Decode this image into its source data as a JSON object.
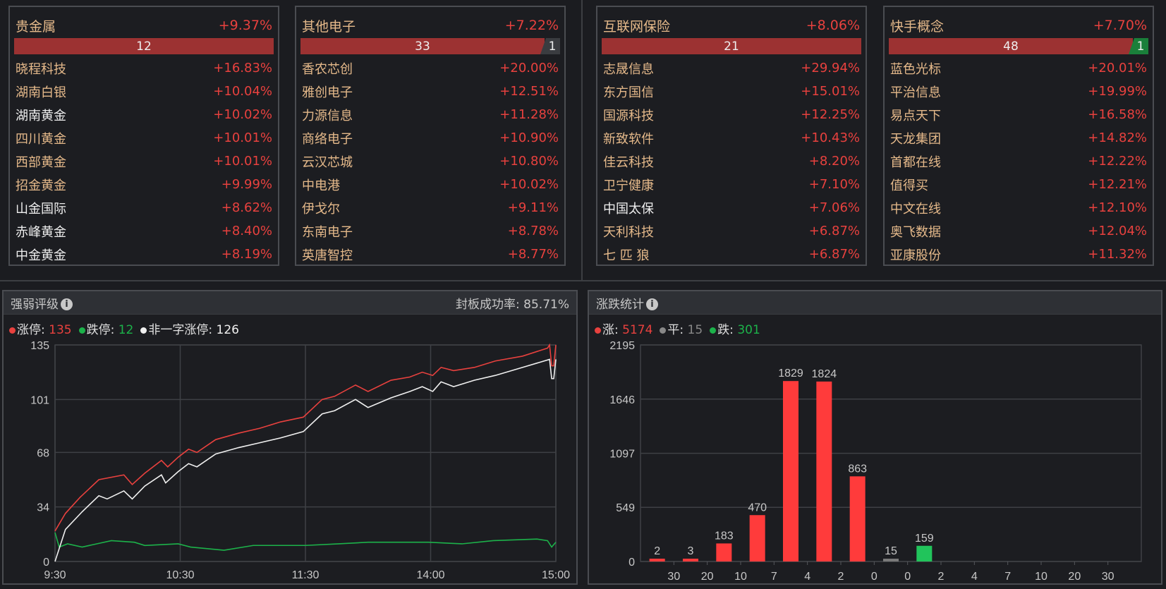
{
  "colors": {
    "up": "#e8413e",
    "down": "#1cb24a",
    "flat": "#888888",
    "white": "#f0f0f0",
    "bar_up": "#ff3b3b",
    "bar_down": "#21c45b",
    "bar_flat": "#7a7a7a"
  },
  "sectors": [
    {
      "name": "贵金属",
      "pct": "+9.37%",
      "up_count": "12",
      "down_count": null,
      "stocks": [
        {
          "name": "晓程科技",
          "pct": "+16.83%",
          "limit": true
        },
        {
          "name": "湖南白银",
          "pct": "+10.04%",
          "limit": true
        },
        {
          "name": "湖南黄金",
          "pct": "+10.02%",
          "limit": false
        },
        {
          "name": "四川黄金",
          "pct": "+10.01%",
          "limit": true
        },
        {
          "name": "西部黄金",
          "pct": "+10.01%",
          "limit": true
        },
        {
          "name": "招金黄金",
          "pct": "+9.99%",
          "limit": true
        },
        {
          "name": "山金国际",
          "pct": "+8.62%",
          "limit": false
        },
        {
          "name": "赤峰黄金",
          "pct": "+8.40%",
          "limit": false
        },
        {
          "name": "中金黄金",
          "pct": "+8.19%",
          "limit": false
        }
      ]
    },
    {
      "name": "其他电子",
      "pct": "+7.22%",
      "up_count": "33",
      "down_count": "1",
      "down_style": "gray",
      "stocks": [
        {
          "name": "香农芯创",
          "pct": "+20.00%",
          "limit": true
        },
        {
          "name": "雅创电子",
          "pct": "+12.51%",
          "limit": true
        },
        {
          "name": "力源信息",
          "pct": "+11.28%",
          "limit": true
        },
        {
          "name": "商络电子",
          "pct": "+10.90%",
          "limit": true
        },
        {
          "name": "云汉芯城",
          "pct": "+10.80%",
          "limit": true
        },
        {
          "name": "中电港",
          "pct": "+10.02%",
          "limit": true
        },
        {
          "name": "伊戈尔",
          "pct": "+9.11%",
          "limit": true
        },
        {
          "name": "东南电子",
          "pct": "+8.78%",
          "limit": true
        },
        {
          "name": "英唐智控",
          "pct": "+8.77%",
          "limit": true
        }
      ]
    },
    {
      "name": "互联网保险",
      "pct": "+8.06%",
      "up_count": "21",
      "down_count": null,
      "stocks": [
        {
          "name": "志晟信息",
          "pct": "+29.94%",
          "limit": true
        },
        {
          "name": "东方国信",
          "pct": "+15.01%",
          "limit": true
        },
        {
          "name": "国源科技",
          "pct": "+12.25%",
          "limit": true
        },
        {
          "name": "新致软件",
          "pct": "+10.43%",
          "limit": true
        },
        {
          "name": "佳云科技",
          "pct": "+8.20%",
          "limit": true
        },
        {
          "name": "卫宁健康",
          "pct": "+7.10%",
          "limit": true
        },
        {
          "name": "中国太保",
          "pct": "+7.06%",
          "limit": false
        },
        {
          "name": "天利科技",
          "pct": "+6.87%",
          "limit": true
        },
        {
          "name": "七 匹 狼",
          "pct": "+6.87%",
          "limit": true
        }
      ]
    },
    {
      "name": "快手概念",
      "pct": "+7.70%",
      "up_count": "48",
      "down_count": "1",
      "down_style": "green",
      "stocks": [
        {
          "name": "蓝色光标",
          "pct": "+20.01%",
          "limit": true
        },
        {
          "name": "平治信息",
          "pct": "+19.99%",
          "limit": true
        },
        {
          "name": "易点天下",
          "pct": "+16.58%",
          "limit": true
        },
        {
          "name": "天龙集团",
          "pct": "+14.82%",
          "limit": true
        },
        {
          "name": "首都在线",
          "pct": "+12.22%",
          "limit": true
        },
        {
          "name": "值得买",
          "pct": "+12.21%",
          "limit": true
        },
        {
          "name": "中文在线",
          "pct": "+12.10%",
          "limit": true
        },
        {
          "name": "奥飞数据",
          "pct": "+12.04%",
          "limit": true
        },
        {
          "name": "亚康股份",
          "pct": "+11.32%",
          "limit": true
        }
      ]
    }
  ],
  "strength": {
    "title": "强弱评级",
    "info_icon": "i",
    "seal_label": "封板成功率:",
    "seal_value": "85.71%",
    "legend": [
      {
        "label": "涨停:",
        "value": "135",
        "color": "#e8413e"
      },
      {
        "label": "跌停:",
        "value": "12",
        "color": "#1cb24a"
      },
      {
        "label": "非一字涨停:",
        "value": "126",
        "color": "#f0f0f0"
      }
    ]
  },
  "updown": {
    "title": "涨跌统计",
    "info_icon": "i",
    "legend": [
      {
        "label": "涨:",
        "value": "5174",
        "color": "#e8413e"
      },
      {
        "label": "平:",
        "value": "15",
        "color": "#888888"
      },
      {
        "label": "跌:",
        "value": "301",
        "color": "#1cb24a"
      }
    ]
  },
  "chart_data": [
    {
      "type": "line",
      "title": "强弱评级",
      "x_unit": "minutes since 9:30 (trading)",
      "xlim": [
        0,
        240
      ],
      "ylim": [
        0,
        135
      ],
      "yticks": [
        0,
        34,
        68,
        101,
        135
      ],
      "xticks": [
        {
          "x": 0,
          "label": "9:30"
        },
        {
          "x": 60,
          "label": "10:30"
        },
        {
          "x": 120,
          "label": "11:30"
        },
        {
          "x": 180,
          "label": "14:00"
        },
        {
          "x": 240,
          "label": "15:00"
        }
      ],
      "grid": true,
      "series": [
        {
          "name": "涨停",
          "color": "#e8413e",
          "points": [
            [
              0,
              19
            ],
            [
              5,
              30
            ],
            [
              12,
              40
            ],
            [
              21,
              51
            ],
            [
              33,
              54
            ],
            [
              37,
              48
            ],
            [
              43,
              55
            ],
            [
              51,
              63
            ],
            [
              54,
              59
            ],
            [
              59,
              65
            ],
            [
              64,
              70
            ],
            [
              68,
              68
            ],
            [
              77,
              76
            ],
            [
              88,
              80
            ],
            [
              98,
              83
            ],
            [
              108,
              87
            ],
            [
              119,
              90
            ],
            [
              128,
              101
            ],
            [
              134,
              103
            ],
            [
              144,
              110
            ],
            [
              150,
              106
            ],
            [
              161,
              113
            ],
            [
              170,
              115
            ],
            [
              176,
              118
            ],
            [
              181,
              116
            ],
            [
              185,
              121
            ],
            [
              191,
              119
            ],
            [
              201,
              121
            ],
            [
              211,
              125
            ],
            [
              224,
              128
            ],
            [
              236,
              133
            ],
            [
              237,
              135
            ],
            [
              238,
              122
            ],
            [
              239,
              122
            ],
            [
              240,
              135
            ]
          ]
        },
        {
          "name": "非一字涨停",
          "color": "#f0f0f0",
          "points": [
            [
              0,
              0
            ],
            [
              5,
              20
            ],
            [
              13,
              31
            ],
            [
              21,
              41
            ],
            [
              25,
              39
            ],
            [
              33,
              44
            ],
            [
              37,
              39
            ],
            [
              43,
              47
            ],
            [
              51,
              54
            ],
            [
              53,
              49
            ],
            [
              59,
              56
            ],
            [
              64,
              61
            ],
            [
              68,
              59
            ],
            [
              77,
              67
            ],
            [
              88,
              71
            ],
            [
              98,
              74
            ],
            [
              108,
              77
            ],
            [
              119,
              81
            ],
            [
              128,
              92
            ],
            [
              134,
              94
            ],
            [
              144,
              101
            ],
            [
              150,
              96
            ],
            [
              161,
              102
            ],
            [
              170,
              106
            ],
            [
              176,
              109
            ],
            [
              181,
              106
            ],
            [
              185,
              112
            ],
            [
              191,
              109
            ],
            [
              201,
              113
            ],
            [
              211,
              116
            ],
            [
              224,
              121
            ],
            [
              237,
              126
            ],
            [
              238,
              114
            ],
            [
              239,
              114
            ],
            [
              240,
              126
            ]
          ]
        },
        {
          "name": "跌停",
          "color": "#1cb24a",
          "points": [
            [
              0,
              18
            ],
            [
              2,
              9
            ],
            [
              6,
              11
            ],
            [
              13,
              9
            ],
            [
              20,
              11
            ],
            [
              27,
              13
            ],
            [
              38,
              12
            ],
            [
              43,
              10
            ],
            [
              59,
              11
            ],
            [
              65,
              9
            ],
            [
              81,
              7
            ],
            [
              95,
              10
            ],
            [
              120,
              10
            ],
            [
              136,
              11
            ],
            [
              150,
              12
            ],
            [
              179,
              12
            ],
            [
              195,
              11
            ],
            [
              210,
              13
            ],
            [
              231,
              14
            ],
            [
              236,
              13
            ],
            [
              238,
              9
            ],
            [
              240,
              12
            ]
          ]
        }
      ]
    },
    {
      "type": "bar",
      "title": "涨跌统计",
      "ylim": [
        0,
        2195
      ],
      "yticks": [
        0,
        549,
        1097,
        1646,
        2195
      ],
      "grid": true,
      "bars": [
        {
          "value": 2,
          "label": "2",
          "kind": "up"
        },
        {
          "value": 3,
          "label": "3",
          "kind": "up"
        },
        {
          "value": 183,
          "label": "183",
          "kind": "up"
        },
        {
          "value": 470,
          "label": "470",
          "kind": "up"
        },
        {
          "value": 1829,
          "label": "1829",
          "kind": "up"
        },
        {
          "value": 1824,
          "label": "1824",
          "kind": "up"
        },
        {
          "value": 863,
          "label": "863",
          "kind": "up"
        },
        {
          "value": 15,
          "label": "15",
          "kind": "flat"
        },
        {
          "value": 159,
          "label": "159",
          "kind": "down"
        }
      ],
      "slots": 15,
      "xtick_labels": [
        "30",
        "20",
        "10",
        "7",
        "4",
        "2",
        "0",
        "0",
        "2",
        "4",
        "7",
        "10",
        "20",
        "30"
      ]
    }
  ]
}
